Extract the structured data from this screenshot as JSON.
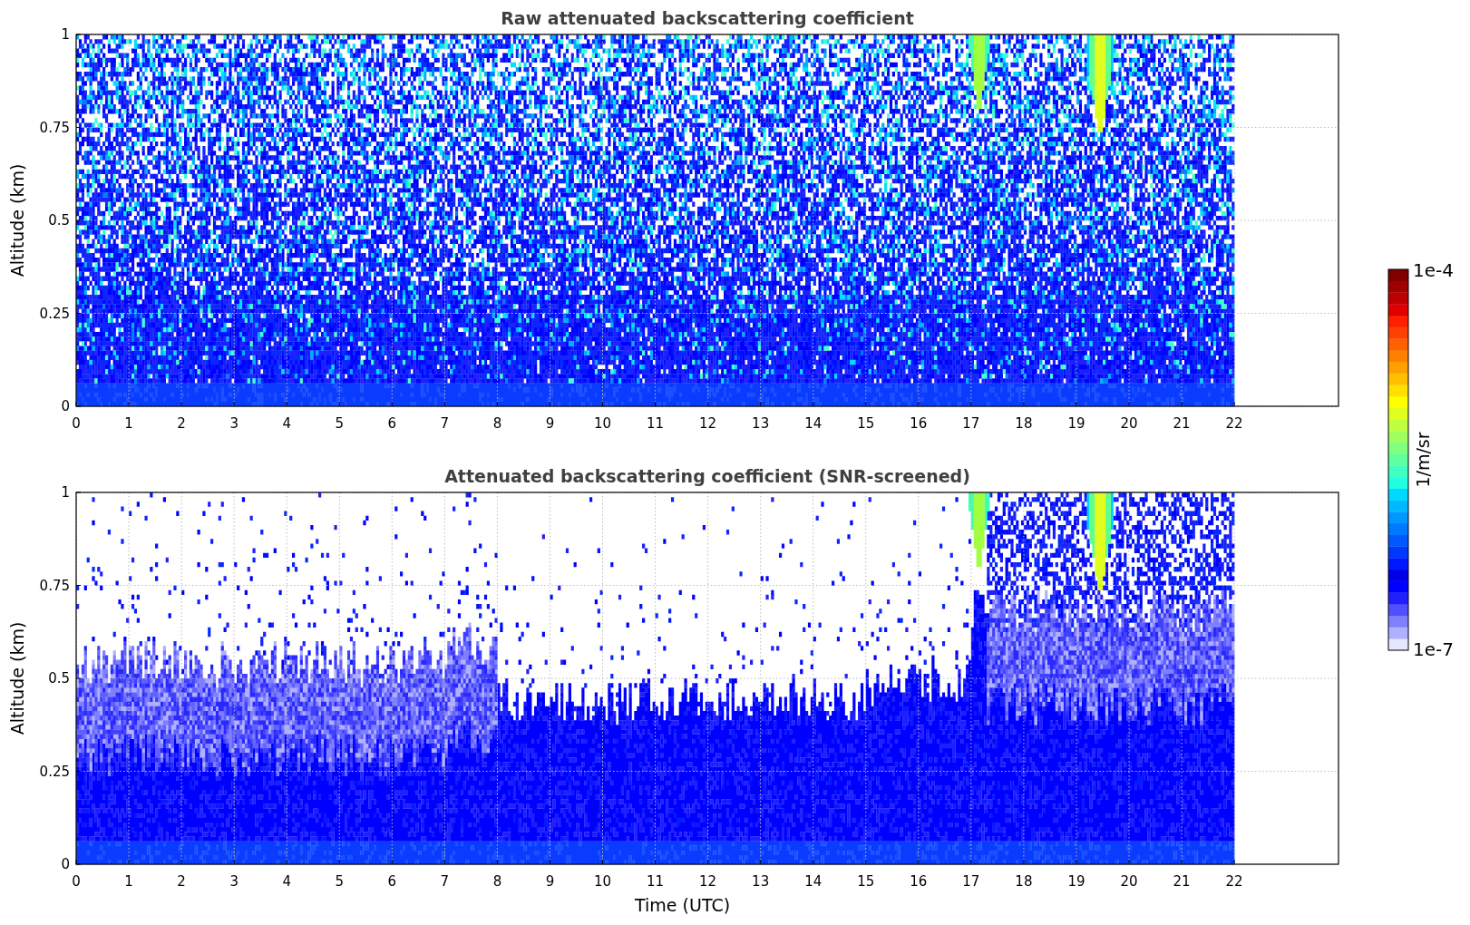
{
  "panels": [
    {
      "kind": "raw",
      "title": "Raw attenuated backscattering coefficient",
      "ylabel": "Altitude (km)",
      "yticks": [
        "1",
        "0.75",
        "0.5",
        "0.25",
        "0"
      ],
      "xticks": [
        "0",
        "1",
        "2",
        "3",
        "4",
        "5",
        "6",
        "7",
        "8",
        "9",
        "10",
        "11",
        "12",
        "13",
        "14",
        "15",
        "16",
        "17",
        "18",
        "19",
        "20",
        "21",
        "22"
      ]
    },
    {
      "kind": "screened",
      "title": "Attenuated backscattering coefficient (SNR-screened)",
      "ylabel": "Altitude (km)",
      "yticks": [
        "1",
        "0.75",
        "0.5",
        "0.25",
        "0"
      ],
      "xticks": [
        "0",
        "1",
        "2",
        "3",
        "4",
        "5",
        "6",
        "7",
        "8",
        "9",
        "10",
        "11",
        "12",
        "13",
        "14",
        "15",
        "16",
        "17",
        "18",
        "19",
        "20",
        "21",
        "22"
      ],
      "xlabel": "Time (UTC)"
    }
  ],
  "colorbar": {
    "max_label": "1e-4",
    "min_label": "1e-7",
    "unit": "1/m/sr"
  }
}
